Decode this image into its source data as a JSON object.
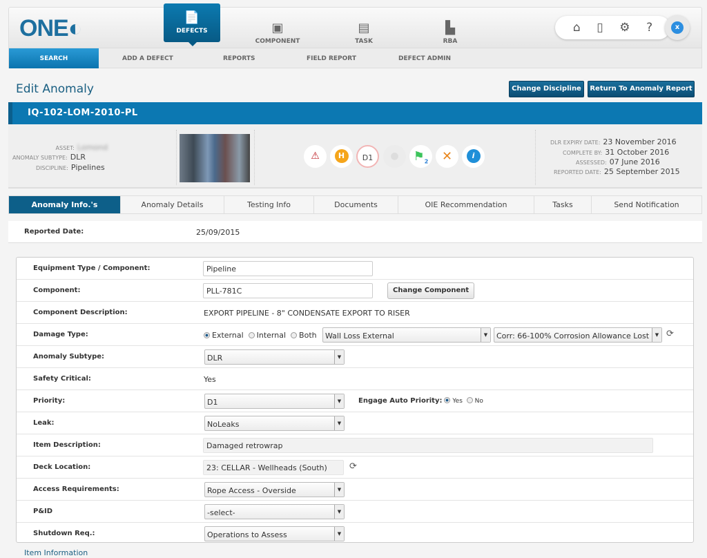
{
  "header": {
    "logo": "ONE",
    "modules": [
      {
        "label": "DEFECTS",
        "icon": "defects-icon",
        "active": true
      },
      {
        "label": "COMPONENT",
        "icon": "component-icon"
      },
      {
        "label": "TASK",
        "icon": "task-icon"
      },
      {
        "label": "RBA",
        "icon": "rba-icon"
      }
    ],
    "tools": [
      "home-icon",
      "document-settings-icon",
      "settings-icon",
      "help-icon"
    ],
    "close_label": "x"
  },
  "subnav": [
    "SEARCH",
    "ADD A DEFECT",
    "REPORTS",
    "FIELD REPORT",
    "DEFECT ADMIN"
  ],
  "page": {
    "title": "Edit Anomaly",
    "change_discipline": "Change Discipline",
    "return_report": "Return To Anomaly Report"
  },
  "banner": "IQ-102-LOM-2010-PL",
  "info": {
    "asset_label": "ASSET:",
    "asset": "Lomond",
    "subtype_label": "ANOMALY SUBTYPE:",
    "subtype": "DLR",
    "discipline_label": "DISCIPLINE:",
    "discipline": "Pipelines",
    "status_icons": [
      {
        "name": "warning-icon",
        "text": "⚠"
      },
      {
        "name": "h-badge-icon",
        "text": "H"
      },
      {
        "name": "priority-d1-icon",
        "text": "D1"
      },
      {
        "name": "leak-drop-icon",
        "text": "●"
      },
      {
        "name": "flag-icon",
        "text": "⚑",
        "sub": "2"
      },
      {
        "name": "tools-icon",
        "text": "✕"
      },
      {
        "name": "info-icon",
        "text": "i"
      }
    ],
    "dates": [
      {
        "label": "DLR EXPIRY DATE:",
        "value": "23 November 2016"
      },
      {
        "label": "COMPLETE BY:",
        "value": "31 October 2016"
      },
      {
        "label": "ASSESSED:",
        "value": "07 June 2016"
      },
      {
        "label": "REPORTED DATE:",
        "value": "25 September 2015"
      }
    ]
  },
  "steps": [
    "Anomaly Info.'s",
    "Anomaly Details",
    "Testing Info",
    "Documents",
    "OIE Recommendation",
    "Tasks",
    "Send Notification"
  ],
  "reported": {
    "label": "Reported Date:",
    "value": "25/09/2015"
  },
  "form": {
    "equipment": {
      "label": "Equipment Type / Component:",
      "value": "Pipeline"
    },
    "component": {
      "label": "Component:",
      "value": "PLL-781C",
      "button": "Change Component"
    },
    "description": {
      "label": "Component Description:",
      "value": "EXPORT PIPELINE - 8\" CONDENSATE EXPORT TO RISER"
    },
    "damage": {
      "label": "Damage Type:",
      "options": [
        "External",
        "Internal",
        "Both"
      ],
      "selected": "External",
      "type": "Wall Loss External",
      "detail": "Corr: 66-100% Corrosion Allowance Lost"
    },
    "subtype": {
      "label": "Anomaly Subtype:",
      "value": "DLR"
    },
    "safety": {
      "label": "Safety Critical:",
      "value": "Yes"
    },
    "priority": {
      "label": "Priority:",
      "value": "D1",
      "auto_label": "Engage Auto Priority:",
      "yes": "Yes",
      "no": "No",
      "auto": "Yes"
    },
    "leak": {
      "label": "Leak:",
      "value": "NoLeaks"
    },
    "item_description": {
      "label": "Item Description:",
      "value": "Damaged retrowrap"
    },
    "deck": {
      "label": "Deck Location:",
      "value": "23: CELLAR - Wellheads (South)"
    },
    "access": {
      "label": "Access Requirements:",
      "value": "Rope Access - Overside"
    },
    "pid": {
      "label": "P&ID",
      "value": "-select-"
    },
    "shutdown": {
      "label": "Shutdown Req.:",
      "value": "Operations to Assess"
    }
  },
  "item_information": "Item Information"
}
